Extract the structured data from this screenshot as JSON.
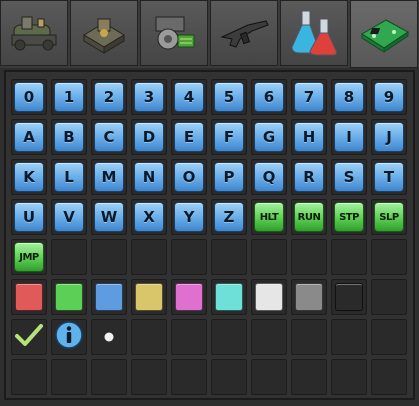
{
  "tabs": [
    {
      "name": "logistics-tab",
      "icon": "conveyor-machinery-icon",
      "active": false
    },
    {
      "name": "production-tab",
      "icon": "factory-machine-icon",
      "active": false
    },
    {
      "name": "intermediate-tab",
      "icon": "gear-circuit-icon",
      "active": false
    },
    {
      "name": "combat-tab",
      "icon": "rifle-icon",
      "active": false
    },
    {
      "name": "science-tab",
      "icon": "flasks-icon",
      "active": false
    },
    {
      "name": "signals-tab",
      "icon": "circuit-board-icon",
      "active": true
    }
  ],
  "signals": {
    "digits": [
      "0",
      "1",
      "2",
      "3",
      "4",
      "5",
      "6",
      "7",
      "8",
      "9"
    ],
    "letters_row1": [
      "A",
      "B",
      "C",
      "D",
      "E",
      "F",
      "G",
      "H",
      "I",
      "J"
    ],
    "letters_row2": [
      "K",
      "L",
      "M",
      "N",
      "O",
      "P",
      "Q",
      "R",
      "S",
      "T"
    ],
    "letters_row3": [
      "U",
      "V",
      "W",
      "X",
      "Y",
      "Z"
    ],
    "commands_row3": [
      "HLT",
      "RUN",
      "STP",
      "SLP"
    ],
    "commands_row4": [
      "JMP"
    ],
    "colors": [
      {
        "name": "red",
        "color": "#e05a5a"
      },
      {
        "name": "green",
        "color": "#5ccf57"
      },
      {
        "name": "blue",
        "color": "#5e9be0"
      },
      {
        "name": "yellow",
        "color": "#d9c56a"
      },
      {
        "name": "pink",
        "color": "#e070d0"
      },
      {
        "name": "cyan",
        "color": "#6fe0d8"
      },
      {
        "name": "white",
        "color": "#e6e6e6"
      },
      {
        "name": "grey",
        "color": "#8a8a8a"
      },
      {
        "name": "black",
        "color": "#2a2a2a"
      }
    ],
    "misc": [
      "check-icon",
      "info-icon",
      "dot-icon"
    ]
  }
}
